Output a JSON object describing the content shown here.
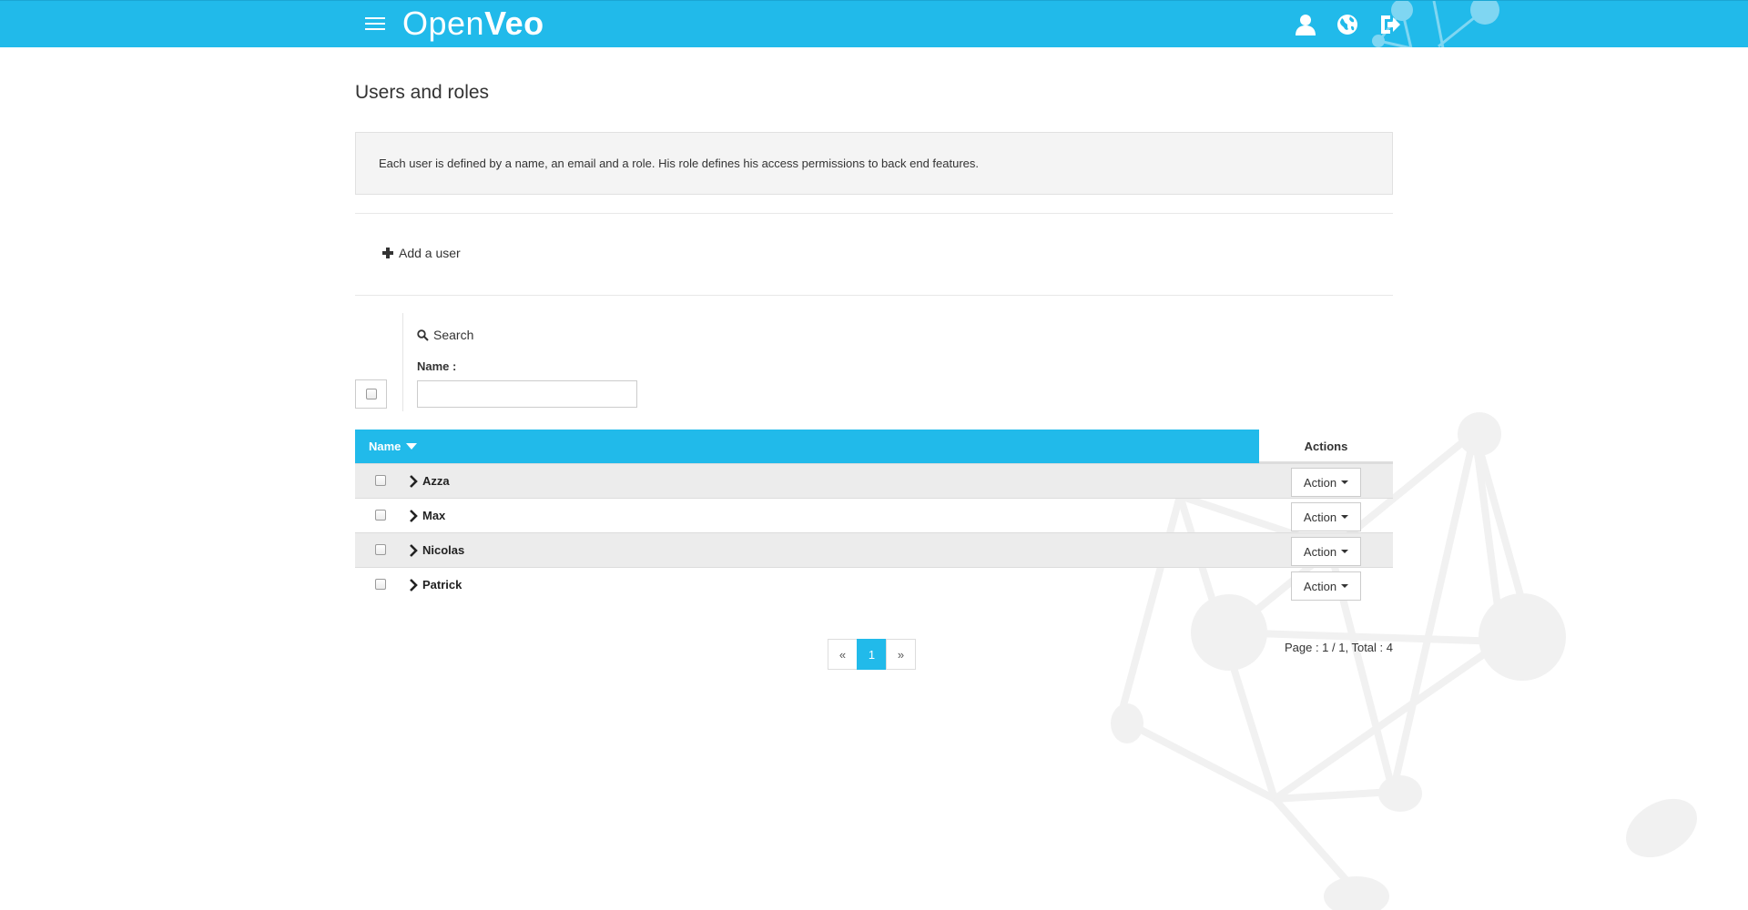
{
  "header": {
    "logo_part1": "Open",
    "logo_part2": "Veo",
    "icons": [
      "menu-icon",
      "user-icon",
      "globe-icon",
      "logout-icon"
    ]
  },
  "page": {
    "title": "Users and roles",
    "info": "Each user is defined by a name, an email and a role. His role defines his access permissions to back end features.",
    "add_user_label": "Add a user"
  },
  "search": {
    "label": "Search",
    "name_label": "Name :",
    "name_value": "",
    "name_placeholder": ""
  },
  "table": {
    "columns": [
      "Name",
      "Actions"
    ],
    "sort_column": "Name",
    "sort_direction": "descending",
    "rows": [
      {
        "name": "Azza",
        "action": "Action"
      },
      {
        "name": "Max",
        "action": "Action"
      },
      {
        "name": "Nicolas",
        "action": "Action"
      },
      {
        "name": "Patrick",
        "action": "Action"
      }
    ]
  },
  "pagination": {
    "prev": "«",
    "pages": [
      "1"
    ],
    "current": "1",
    "next": "»",
    "info": "Page : 1 / 1, Total : 4"
  },
  "colors": {
    "brand": "#21baea",
    "row_alt": "#ececec",
    "info_bg": "#f4f4f4"
  }
}
